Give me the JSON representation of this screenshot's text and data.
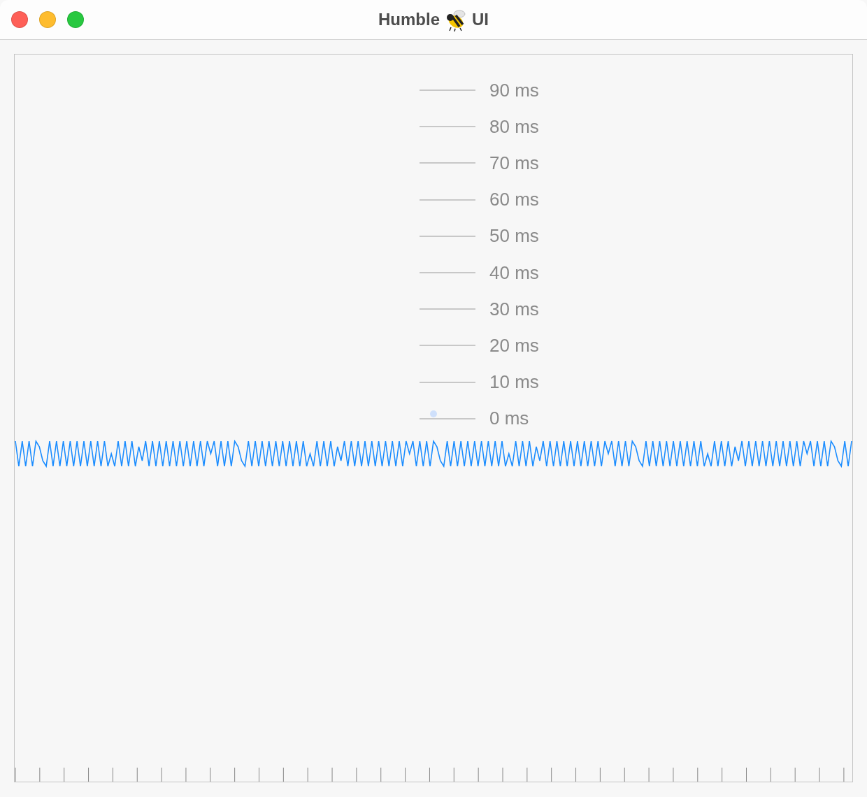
{
  "window": {
    "title_before": "Humble",
    "title_after": "UI"
  },
  "legend": [
    {
      "label": "90 ms"
    },
    {
      "label": "80 ms"
    },
    {
      "label": "70 ms"
    },
    {
      "label": "60 ms"
    },
    {
      "label": "50 ms"
    },
    {
      "label": "40 ms"
    },
    {
      "label": "30 ms"
    },
    {
      "label": "20 ms"
    },
    {
      "label": "10 ms"
    },
    {
      "label": "0 ms",
      "marker": true
    }
  ]
}
